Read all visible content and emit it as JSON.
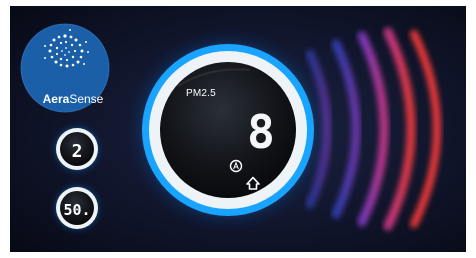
{
  "brand": {
    "name_part1": "Aera",
    "name_part2": "Sense",
    "logo_icon": "dotted-swirl-icon"
  },
  "main_display": {
    "label": "PM2.5",
    "value_glyph": "8",
    "mode_icon": "auto-mode-icon",
    "secondary_icon": "home-up-arrow-icon"
  },
  "small_display_1": {
    "value": "2"
  },
  "small_display_2": {
    "value": "50."
  },
  "colors": {
    "background_dark": "#0b0e1e",
    "ring_glow": "#1aa8ff",
    "ring_white": "#eef3f8",
    "display_black": "#0d0f13",
    "badge_blue": "#1b5fa8",
    "wave_blue": "#3c4ee0",
    "wave_purple": "#8a3fd2",
    "wave_pink": "#d43a8f",
    "wave_red": "#f23b3b"
  }
}
